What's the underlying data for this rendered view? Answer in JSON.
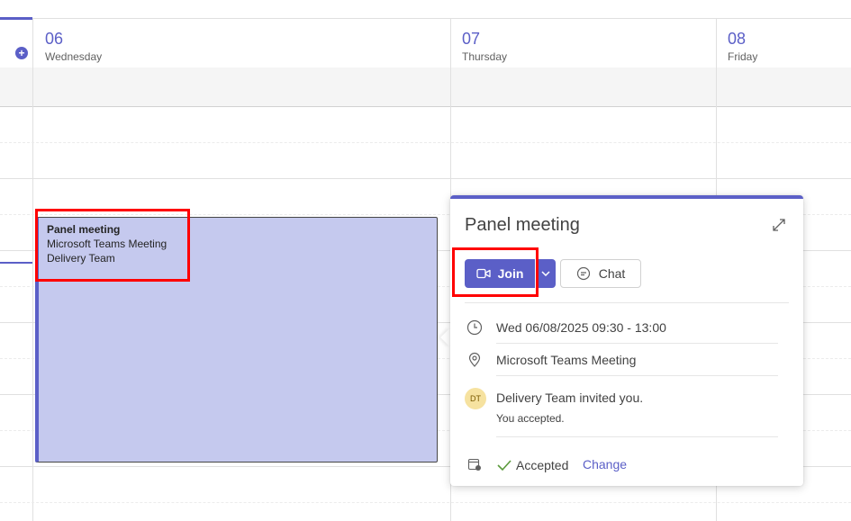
{
  "calendar": {
    "days": [
      {
        "number": "06",
        "name": "Wednesday"
      },
      {
        "number": "07",
        "name": "Thursday"
      },
      {
        "number": "08",
        "name": "Friday"
      }
    ],
    "accent_color": "#5b5fc7"
  },
  "event": {
    "title": "Panel meeting",
    "location": "Microsoft Teams Meeting",
    "organizer": "Delivery Team",
    "color": "#c5c9ee"
  },
  "popup": {
    "title": "Panel meeting",
    "join_label": "Join",
    "chat_label": "Chat",
    "datetime": "Wed 06/08/2025 09:30 - 13:00",
    "location": "Microsoft Teams Meeting",
    "avatar_initials": "DT",
    "invite_text": "Delivery Team invited you.",
    "response_text": "You accepted.",
    "status_label": "Accepted",
    "change_label": "Change",
    "icons": {
      "expand": "expand-icon",
      "join": "video-camera-icon",
      "dropdown": "chevron-down-icon",
      "chat": "chat-bubble-icon",
      "time": "clock-icon",
      "location": "location-pin-icon",
      "calendar": "calendar-status-icon",
      "accepted": "checkmark-icon"
    }
  }
}
